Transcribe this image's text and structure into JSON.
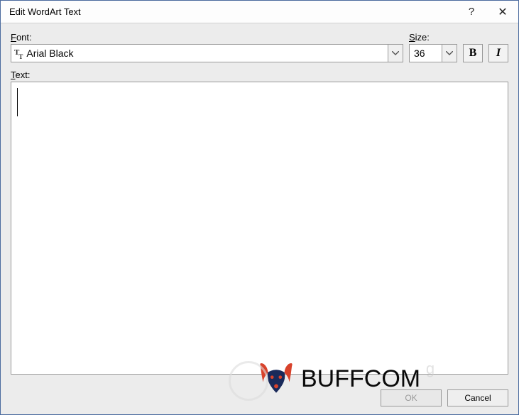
{
  "title": "Edit WordArt Text",
  "help_symbol": "?",
  "close_symbol": "✕",
  "labels": {
    "font_prefix": "F",
    "font_rest": "ont:",
    "size_prefix": "S",
    "size_rest": "ize:",
    "text_prefix": "T",
    "text_rest": "ext:"
  },
  "font": {
    "value": "Arial Black",
    "icon_major": "T",
    "icon_minor": "T"
  },
  "size": {
    "value": "36"
  },
  "style": {
    "bold": "B",
    "italic": "I"
  },
  "text_value": "",
  "buttons": {
    "ok": "OK",
    "cancel": "Cancel"
  },
  "watermark": "BUFFCOM"
}
